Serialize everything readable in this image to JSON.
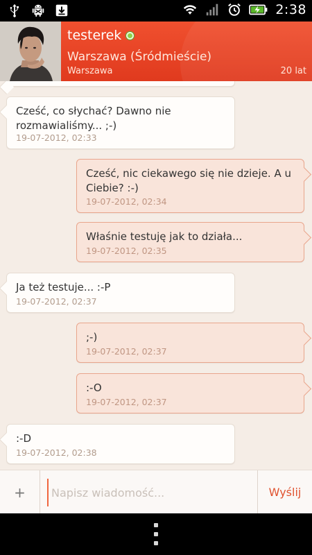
{
  "status_bar": {
    "time": "2:38",
    "left_icons": [
      "usb-icon",
      "android-debug-icon",
      "download-icon"
    ],
    "right_icons": [
      "wifi-icon",
      "signal-icon",
      "alarm-icon",
      "battery-charging-icon"
    ]
  },
  "header": {
    "username": "testerek",
    "online": true,
    "location": "Warszawa (Śródmieście)",
    "city": "Warszawa",
    "age": "20 lat",
    "accent_color": "#e8452a"
  },
  "messages": [
    {
      "direction": "incoming",
      "text": "Cześć, co słychać? Dawno nie rozmawialiśmy... ;-)",
      "time": "19-07-2012, 02:33"
    },
    {
      "direction": "outgoing",
      "text": "Cześć, nic ciekawego się nie dzieje. A u Ciebie? :-)",
      "time": "19-07-2012, 02:34"
    },
    {
      "direction": "outgoing",
      "text": "Właśnie testuję jak to działa...",
      "time": "19-07-2012, 02:35"
    },
    {
      "direction": "incoming",
      "text": "Ja też testuje... :-P",
      "time": "19-07-2012, 02:37"
    },
    {
      "direction": "outgoing",
      "text": ";-)",
      "time": "19-07-2012, 02:37"
    },
    {
      "direction": "outgoing",
      "text": ":-O",
      "time": "19-07-2012, 02:37"
    },
    {
      "direction": "incoming",
      "text": ":-D",
      "time": "19-07-2012, 02:38"
    }
  ],
  "composer": {
    "add_label": "+",
    "placeholder": "Napisz wiadomość...",
    "value": "",
    "send_label": "Wyślij"
  },
  "nav": {
    "menu_icon": "menu-dots-icon"
  }
}
